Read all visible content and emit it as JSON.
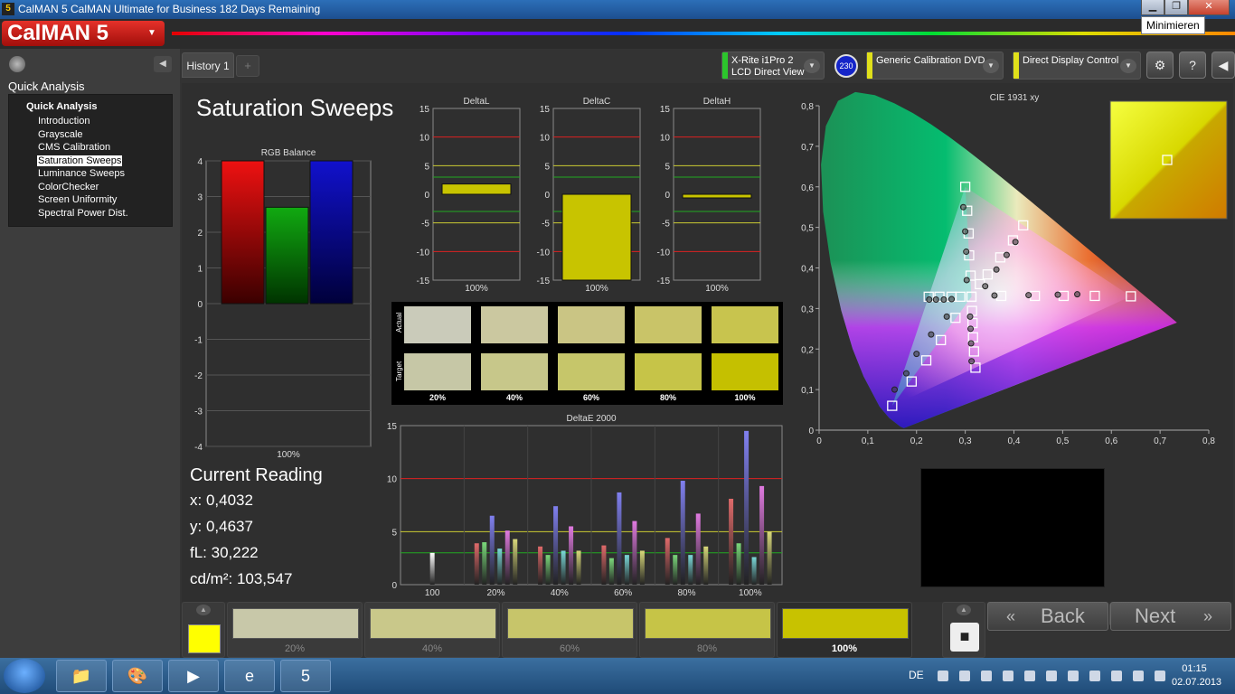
{
  "window": {
    "app_icon": "5",
    "title": "CalMAN 5 CalMAN Ultimate for Business 182 Days Remaining",
    "min_icon": "minimize-icon",
    "max_icon": "maximize-icon",
    "close_icon": "close-icon",
    "min_glyph": "▁",
    "max_glyph": "❐",
    "close_glyph": "✕",
    "tooltip": "Minimieren"
  },
  "brand": {
    "logo_text": "CalMAN 5",
    "caret": "▼"
  },
  "left_panel": {
    "collapse_glyph": "◀",
    "title": "Quick Analysis",
    "tree_root": "Quick Analysis",
    "items": [
      {
        "label": "Introduction",
        "selected": false
      },
      {
        "label": "Grayscale",
        "selected": false
      },
      {
        "label": "CMS Calibration",
        "selected": false
      },
      {
        "label": "Saturation Sweeps",
        "selected": true
      },
      {
        "label": "Luminance Sweeps",
        "selected": false
      },
      {
        "label": "ColorChecker",
        "selected": false
      },
      {
        "label": "Screen Uniformity",
        "selected": false
      },
      {
        "label": "Spectral Power Dist.",
        "selected": false
      }
    ]
  },
  "tabs": {
    "history": "History 1",
    "add": "+"
  },
  "devices": {
    "meter": {
      "line1": "X-Rite i1Pro 2",
      "line2": "LCD Direct View",
      "color": "#2cc52c"
    },
    "badge": "230",
    "source": {
      "line1": "Generic Calibration DVD",
      "color": "#e0e01a"
    },
    "display": {
      "line1": "Direct Display Control",
      "color": "#e0e01a"
    },
    "dropdown_glyph": "▼",
    "settings_glyph": "⚙",
    "help_glyph": "?",
    "collapse_glyph": "◀"
  },
  "page": {
    "title": "Saturation Sweeps"
  },
  "rgb_balance": {
    "title": "RGB Balance",
    "ticks": [
      "4",
      "3",
      "2",
      "1",
      "0",
      "-1",
      "-2",
      "-3",
      "-4"
    ],
    "category": "100%",
    "values": {
      "r": 4.0,
      "g": 2.7,
      "b": 4.0
    }
  },
  "delta_l": {
    "title": "DeltaL",
    "category": "100%",
    "value": 1.8
  },
  "delta_c": {
    "title": "DeltaC",
    "category": "100%",
    "value": -15.0
  },
  "delta_h": {
    "title": "DeltaH",
    "category": "100%",
    "value": -0.6
  },
  "delta_ticks": [
    "15",
    "10",
    "5",
    "0",
    "-5",
    "-10",
    "-15"
  ],
  "swatches": {
    "row_actual": "Actual",
    "row_target": "Target",
    "labels": [
      "20%",
      "40%",
      "60%",
      "80%",
      "100%"
    ],
    "actual": [
      "#cacbba",
      "#cbc8a0",
      "#cac584",
      "#c9c468",
      "#c8c44e"
    ],
    "target": [
      "#c6c7a6",
      "#c7c78a",
      "#c6c66a",
      "#c6c448",
      "#c5c000"
    ]
  },
  "chart_data": [
    {
      "type": "bar",
      "title": "DeltaE 2000",
      "categories": [
        "100",
        "20%",
        "40%",
        "60%",
        "80%",
        "100%"
      ],
      "ylim": [
        0,
        15
      ],
      "yticks": [
        "15",
        "10",
        "5",
        "0"
      ],
      "series": [
        {
          "name": "White",
          "color": "#ffffff",
          "values": [
            3.0,
            null,
            null,
            null,
            null,
            null
          ]
        },
        {
          "name": "Red",
          "color": "#e06a6a",
          "values": [
            null,
            3.9,
            3.6,
            3.7,
            4.4,
            8.1
          ]
        },
        {
          "name": "Green",
          "color": "#7ad87a",
          "values": [
            null,
            4.0,
            2.8,
            2.5,
            2.8,
            3.9
          ]
        },
        {
          "name": "Blue",
          "color": "#8080f0",
          "values": [
            null,
            6.5,
            7.4,
            8.7,
            9.8,
            14.5
          ]
        },
        {
          "name": "Cyan",
          "color": "#7ad8d8",
          "values": [
            null,
            3.4,
            3.2,
            2.8,
            2.8,
            2.6
          ]
        },
        {
          "name": "Magenta",
          "color": "#e07ae0",
          "values": [
            null,
            5.1,
            5.5,
            6.0,
            6.7,
            9.3
          ]
        },
        {
          "name": "Yellow",
          "color": "#d8d87a",
          "values": [
            null,
            4.3,
            3.2,
            3.2,
            3.6,
            5.0
          ]
        }
      ],
      "thresholds": [
        10,
        5,
        3
      ]
    },
    {
      "type": "scatter",
      "title": "CIE 1931 xy",
      "xlim": [
        0,
        0.8
      ],
      "ylim": [
        0,
        0.8
      ],
      "xticks": [
        "0",
        "0,1",
        "0,2",
        "0,3",
        "0,4",
        "0,5",
        "0,6",
        "0,7",
        "0,8"
      ],
      "yticks": [
        "0,8",
        "0,7",
        "0,6",
        "0,5",
        "0,4",
        "0,3",
        "0,2",
        "0,1",
        "0"
      ],
      "gamut": [
        [
          0.64,
          0.33
        ],
        [
          0.3,
          0.6
        ],
        [
          0.15,
          0.06
        ]
      ],
      "white": [
        0.3127,
        0.329
      ],
      "targets": [
        [
          0.64,
          0.33
        ],
        [
          0.566,
          0.331
        ],
        [
          0.502,
          0.331
        ],
        [
          0.443,
          0.331
        ],
        [
          0.374,
          0.331
        ],
        [
          0.3,
          0.6
        ],
        [
          0.304,
          0.541
        ],
        [
          0.307,
          0.485
        ],
        [
          0.308,
          0.431
        ],
        [
          0.311,
          0.381
        ],
        [
          0.15,
          0.06
        ],
        [
          0.19,
          0.12
        ],
        [
          0.22,
          0.172
        ],
        [
          0.25,
          0.222
        ],
        [
          0.28,
          0.277
        ],
        [
          0.225,
          0.329
        ],
        [
          0.247,
          0.329
        ],
        [
          0.272,
          0.329
        ],
        [
          0.29,
          0.329
        ],
        [
          0.321,
          0.154
        ],
        [
          0.318,
          0.194
        ],
        [
          0.316,
          0.229
        ],
        [
          0.315,
          0.264
        ],
        [
          0.314,
          0.294
        ],
        [
          0.419,
          0.505
        ],
        [
          0.398,
          0.468
        ],
        [
          0.372,
          0.426
        ],
        [
          0.346,
          0.384
        ],
        [
          0.33,
          0.36
        ]
      ],
      "measured": [
        [
          0.53,
          0.335
        ],
        [
          0.49,
          0.334
        ],
        [
          0.43,
          0.333
        ],
        [
          0.36,
          0.332
        ],
        [
          0.296,
          0.55
        ],
        [
          0.3,
          0.49
        ],
        [
          0.302,
          0.44
        ],
        [
          0.303,
          0.37
        ],
        [
          0.155,
          0.1
        ],
        [
          0.179,
          0.14
        ],
        [
          0.2,
          0.188
        ],
        [
          0.23,
          0.236
        ],
        [
          0.262,
          0.28
        ],
        [
          0.226,
          0.322
        ],
        [
          0.24,
          0.322
        ],
        [
          0.256,
          0.322
        ],
        [
          0.272,
          0.323
        ],
        [
          0.313,
          0.17
        ],
        [
          0.312,
          0.214
        ],
        [
          0.311,
          0.25
        ],
        [
          0.31,
          0.28
        ],
        [
          0.403,
          0.464
        ],
        [
          0.385,
          0.432
        ],
        [
          0.364,
          0.396
        ],
        [
          0.341,
          0.355
        ]
      ],
      "current": [
        0.4032,
        0.4637
      ]
    }
  ],
  "current_reading": {
    "title": "Current Reading",
    "x": "x: 0,4032",
    "y": "y: 0,4637",
    "fl": "fL: 30,222",
    "cdm2": "cd/m²: 103,547"
  },
  "bottom": {
    "up_glyph": "▲",
    "current_color": "#ffff00",
    "steps": [
      {
        "label": "20%",
        "color": "#c8c8a9",
        "active": false
      },
      {
        "label": "40%",
        "color": "#c9c88a",
        "active": false
      },
      {
        "label": "60%",
        "color": "#c7c56a",
        "active": false
      },
      {
        "label": "80%",
        "color": "#c6c447",
        "active": false
      },
      {
        "label": "100%",
        "color": "#c8c200",
        "active": true
      }
    ],
    "controls": [
      "■",
      "▶",
      "[•]",
      "∞",
      "↻",
      "●"
    ],
    "stop_glyph": "■",
    "back_label": "Back",
    "next_label": "Next",
    "back_glyph": "«",
    "next_glyph": "»"
  },
  "taskbar": {
    "apps": [
      "📁",
      "🎨",
      "▶",
      "e",
      "5"
    ],
    "lang": "DE",
    "time": "01:15",
    "date": "02.07.2013"
  }
}
